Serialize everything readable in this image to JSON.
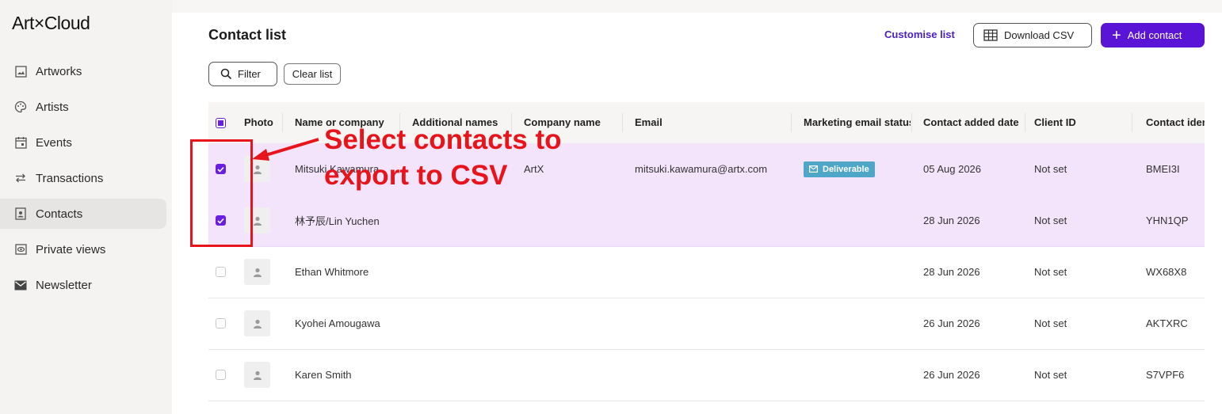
{
  "app": {
    "logo": "Art×Cloud"
  },
  "sidebar": {
    "items": [
      {
        "label": "Artworks",
        "icon": "image-icon"
      },
      {
        "label": "Artists",
        "icon": "palette-icon"
      },
      {
        "label": "Events",
        "icon": "calendar-icon"
      },
      {
        "label": "Transactions",
        "icon": "transfer-icon"
      },
      {
        "label": "Contacts",
        "icon": "contact-card-icon",
        "active": true
      },
      {
        "label": "Private views",
        "icon": "eye-icon"
      },
      {
        "label": "Newsletter",
        "icon": "mail-icon"
      }
    ]
  },
  "header": {
    "title": "Contact list",
    "customise_label": "Customise list",
    "download_label": "Download CSV",
    "add_label": "Add contact"
  },
  "filters": {
    "filter_label": "Filter",
    "clear_label": "Clear list"
  },
  "table": {
    "columns": [
      "Photo",
      "Name or company",
      "Additional names",
      "Company name",
      "Email",
      "Marketing email status",
      "Contact added date",
      "Client ID",
      "Contact identifier"
    ],
    "rows": [
      {
        "selected": true,
        "name": "Mitsuki Kawamura",
        "company": "ArtX",
        "email": "mitsuki.kawamura@artx.com",
        "marketing": "Deliverable",
        "added": "05 Aug 2026",
        "client_id": "Not set",
        "identifier": "BMEI3I"
      },
      {
        "selected": true,
        "name": "林予辰/Lin Yuchen",
        "company": "",
        "email": "",
        "marketing": "",
        "added": "28 Jun 2026",
        "client_id": "Not set",
        "identifier": "YHN1QP"
      },
      {
        "selected": false,
        "name": "Ethan Whitmore",
        "company": "",
        "email": "",
        "marketing": "",
        "added": "28 Jun 2026",
        "client_id": "Not set",
        "identifier": "WX68X8"
      },
      {
        "selected": false,
        "name": "Kyohei Amougawa",
        "company": "",
        "email": "",
        "marketing": "",
        "added": "26 Jun 2026",
        "client_id": "Not set",
        "identifier": "AKTXRC"
      },
      {
        "selected": false,
        "name": "Karen Smith",
        "company": "",
        "email": "",
        "marketing": "",
        "added": "26 Jun 2026",
        "client_id": "Not set",
        "identifier": "S7VPF6"
      }
    ]
  },
  "annotation": {
    "line1": "Select contacts to",
    "line2": "export to CSV",
    "color": "#e8141c"
  },
  "colors": {
    "accent": "#5a14d6",
    "selected_row": "#f3e4fb",
    "badge": "#4ea6c9"
  }
}
